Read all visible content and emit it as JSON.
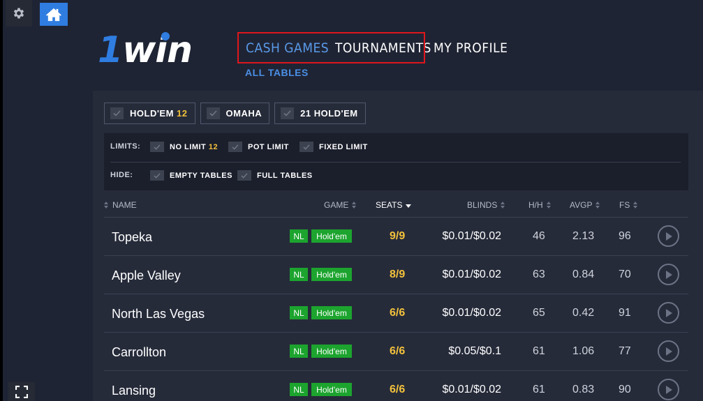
{
  "brand": {
    "one": "1",
    "win": "win"
  },
  "nav": {
    "cash_games": "CASH GAMES",
    "tournaments": "TOURNAMENTS",
    "my_profile": "MY PROFILE",
    "sub": "ALL TABLES"
  },
  "game_filters": [
    {
      "label": "HOLD'EM",
      "count": "12"
    },
    {
      "label": "OMAHA",
      "count": ""
    },
    {
      "label": "21 HOLD'EM",
      "count": ""
    }
  ],
  "limits": {
    "label": "LIMITS:",
    "options": [
      {
        "label": "NO LIMIT",
        "count": "12"
      },
      {
        "label": "POT LIMIT",
        "count": ""
      },
      {
        "label": "FIXED LIMIT",
        "count": ""
      }
    ]
  },
  "hide": {
    "label": "HIDE:",
    "options": [
      {
        "label": "EMPTY TABLES"
      },
      {
        "label": "FULL TABLES"
      }
    ]
  },
  "columns": {
    "name": "NAME",
    "game": "GAME",
    "seats": "SEATS",
    "blinds": "BLINDS",
    "hh": "H/H",
    "avgp": "AVGP",
    "fs": "FS"
  },
  "tables": [
    {
      "name": "Topeka",
      "limit": "NL",
      "game": "Hold'em",
      "seats": "9/9",
      "blinds": "$0.01/$0.02",
      "hh": "46",
      "avgp": "2.13",
      "fs": "96"
    },
    {
      "name": "Apple Valley",
      "limit": "NL",
      "game": "Hold'em",
      "seats": "8/9",
      "blinds": "$0.01/$0.02",
      "hh": "63",
      "avgp": "0.84",
      "fs": "70"
    },
    {
      "name": "North Las Vegas",
      "limit": "NL",
      "game": "Hold'em",
      "seats": "6/6",
      "blinds": "$0.01/$0.02",
      "hh": "65",
      "avgp": "0.42",
      "fs": "91"
    },
    {
      "name": "Carrollton",
      "limit": "NL",
      "game": "Hold'em",
      "seats": "6/6",
      "blinds": "$0.05/$0.1",
      "hh": "61",
      "avgp": "1.06",
      "fs": "77"
    },
    {
      "name": "Lansing",
      "limit": "NL",
      "game": "Hold'em",
      "seats": "6/6",
      "blinds": "$0.01/$0.02",
      "hh": "61",
      "avgp": "0.83",
      "fs": "90"
    }
  ],
  "colors": {
    "accent_blue": "#2f7de1",
    "highlight_red": "#e0161b",
    "seats_yellow": "#f2c13b",
    "badge_green": "#1ca42e"
  },
  "icons": {
    "settings": "gear-icon",
    "home": "home-icon",
    "fullscreen": "fullscreen-icon",
    "join": "play-icon"
  }
}
